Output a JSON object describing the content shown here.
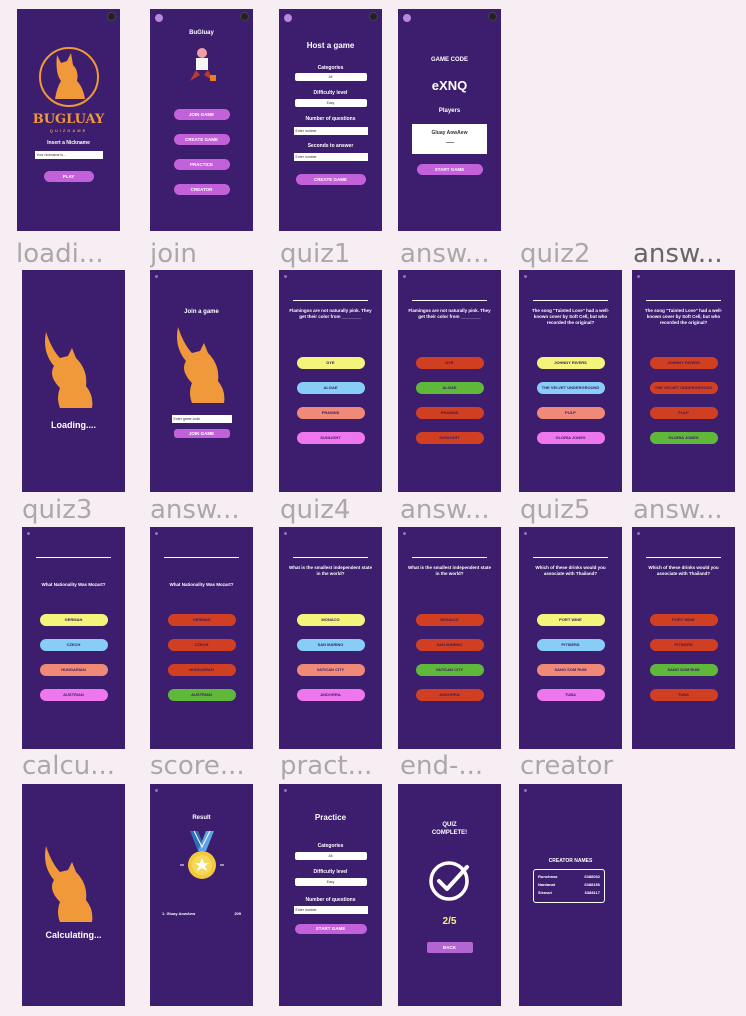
{
  "colors": {
    "frame": "#3c1d6e",
    "pill": "#c361db",
    "yellow": "#f4f37a",
    "blue": "#87cdf6",
    "salmon": "#f08a78",
    "pink": "#ee77ee",
    "red": "#d13f22",
    "green": "#5fb83a",
    "cat": "#f0993a"
  },
  "captions": [
    "loadi...",
    "join",
    "quiz1",
    "answ...",
    "quiz2",
    "answ...",
    "quiz3",
    "answ...",
    "quiz4",
    "answ...",
    "quiz5",
    "answ...",
    "calcu...",
    "score...",
    "pract...",
    "end-...",
    "creator"
  ],
  "home": {
    "logo_title": "BUGLUAY",
    "logo_sub": "QUIZGAME",
    "label": "Insert a Nickname",
    "input_placeholder": "Your nickname is...",
    "play": "PLAY"
  },
  "menu": {
    "title": "BuGluay",
    "buttons": [
      "JOIN GAME",
      "CREATE GAME",
      "PRACTICE",
      "CREATOR"
    ]
  },
  "host": {
    "title": "Host a game",
    "cat_label": "Categories",
    "cat_value": "All",
    "diff_label": "Difficulty level",
    "diff_value": "Easy",
    "num_label": "Number of questions",
    "num_placeholder": "Enter number",
    "sec_label": "Seconds to answer",
    "sec_placeholder": "Enter number",
    "button": "CREATE GAME"
  },
  "lobby": {
    "code_label": "GAME CODE",
    "code": "eXNQ",
    "players_label": "Players",
    "player": "Gluay AowAew",
    "button": "START GAME"
  },
  "loading": {
    "text": "Loading...."
  },
  "join": {
    "title": "Join a game",
    "placeholder": "Enter game code",
    "button": "JOIN GAME"
  },
  "quiz1": {
    "q": "Flamingos are not naturally pink. They get their color from ________",
    "options": [
      "DYE",
      "ALGAE",
      "PRAWNS",
      "SUNLIGHT"
    ]
  },
  "quiz2": {
    "q": "The song \"Tainted Love\" had a well-known cover by Soft Cell, but who recorded the original?",
    "options": [
      "JOHNNY RIVERS",
      "THE VELVET UNDERGROUND",
      "PULP",
      "GLORIA JONES"
    ]
  },
  "quiz3": {
    "q": "What Nationality Was Mozart?",
    "options": [
      "GERMAN",
      "CZECH",
      "HUNGARIAN",
      "AUSTRIAN"
    ]
  },
  "quiz4": {
    "q": "What is the smallest independent state in the world?",
    "options": [
      "MONACO",
      "SAN MARINO",
      "VATICAN CITY",
      "ANDORRA"
    ]
  },
  "quiz5": {
    "q": "Which of these drinks would you associate with Thailand?",
    "options": [
      "PORT WINE",
      "PITSIERS",
      "SANG SOM RUM",
      "TUBA"
    ]
  },
  "calculating": {
    "text": "Calculating..."
  },
  "score": {
    "title": "Result",
    "row_name": "1. Gluay AowAew",
    "row_score": "209"
  },
  "practice": {
    "title": "Practice",
    "cat_label": "Categories",
    "cat_value": "All",
    "diff_label": "Difficulty level",
    "diff_value": "Easy",
    "num_label": "Number of questions",
    "num_placeholder": "Enter number",
    "button": "START GAME"
  },
  "end": {
    "title_1": "QUIZ",
    "title_2": "COMPLETE!",
    "score": "2/5",
    "button": "BACK"
  },
  "creator": {
    "title": "CREATOR NAMES",
    "rows": [
      {
        "name": "Runchana",
        "id": "6388032"
      },
      {
        "name": "Nantanat",
        "id": "6388156"
      },
      {
        "name": "Siranut",
        "id": "6388117"
      }
    ]
  }
}
